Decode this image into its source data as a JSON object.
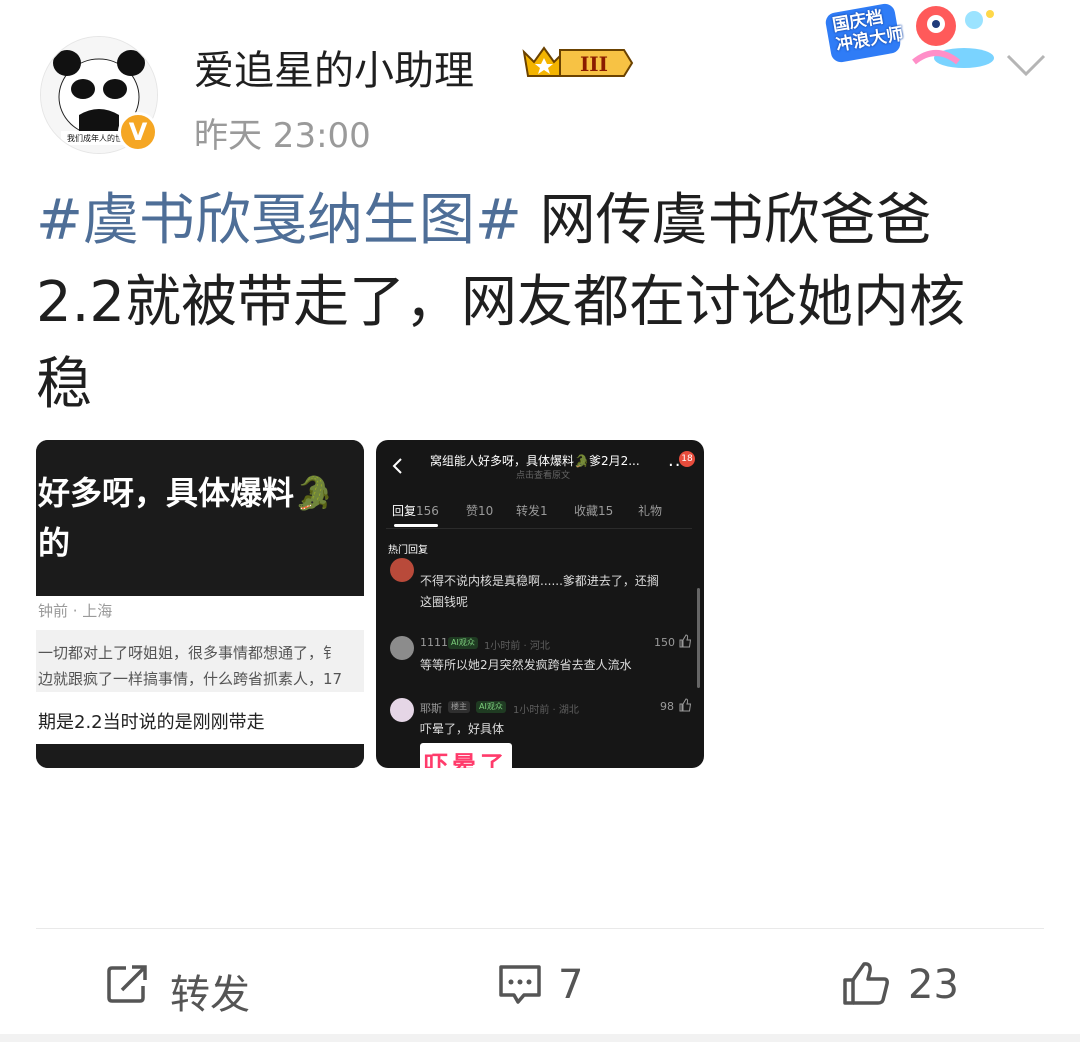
{
  "post": {
    "username": "爱追星的小助理",
    "level_badge": "III",
    "time": "昨天 23:00",
    "verified_mark": "V",
    "avatar_caption": "我们成年人的世界",
    "promo_badge": [
      "国庆档",
      "冲浪大师"
    ],
    "topic_tag": "#虞书欣戛纳生图#",
    "text_line1_rest": " 网传虞书欣爸爸",
    "text_line2": "2.2就被带走了，网友都在讨论她内核",
    "text_line3": "稳"
  },
  "image1": {
    "headline1": "好多呀，具体爆料🐊",
    "headline2": "的",
    "meta": "钟前 · 上海",
    "quote1": "一切都对上了呀姐姐，很多事情都想通了，钅",
    "quote2": "边就跟疯了一样搞事情，什么跨省抓素人，17",
    "line": "期是2.2当时说的是刚刚带走"
  },
  "image2": {
    "title": "窝组能人好多呀，具体爆料🐊爹2月2...",
    "subtitle": "点击查看原文",
    "more": "...",
    "badge": "18",
    "tabs": [
      {
        "label": "回复",
        "count": "156"
      },
      {
        "label": "赞",
        "count": "10"
      },
      {
        "label": "转发",
        "count": "1"
      },
      {
        "label": "收藏",
        "count": "15"
      },
      {
        "label": "礼物",
        "count": ""
      }
    ],
    "section": "热门回复",
    "comments": [
      {
        "text1": "不得不说内核是真稳啊......爹都进去了，还搁",
        "text2": "这圈钱呢"
      },
      {
        "name": "1111",
        "chip": "AI观众",
        "when": "1小时前 · 河北",
        "likes": "150",
        "text1": "等等所以她2月突然发疯跨省去查人流水"
      },
      {
        "name": "耶斯",
        "owner_chip": "楼主",
        "chip": "AI观众",
        "when": "1小时前 · 湖北",
        "likes": "98",
        "text1": "吓晕了，好具体"
      }
    ],
    "sticker": "吓晕了"
  },
  "actions": {
    "repost": "转发",
    "comments": "7",
    "likes": "23"
  }
}
